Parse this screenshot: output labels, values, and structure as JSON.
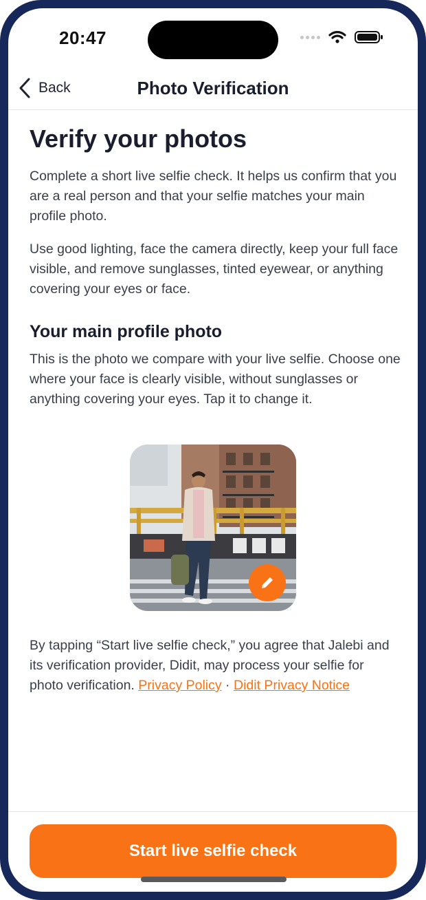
{
  "status_bar": {
    "time": "20:47"
  },
  "nav": {
    "back_label": "Back",
    "title": "Photo Verification"
  },
  "content": {
    "heading": "Verify your photos",
    "intro": "Complete a short live selfie check. It helps us confirm that you are a real person and that your selfie matches your main profile photo.",
    "tips": "Use good lighting, face the camera directly, keep your full face visible, and remove sunglasses, tinted eyewear, or anything covering your eyes or face.",
    "profile_heading": "Your main profile photo",
    "profile_desc": "This is the photo we compare with your live selfie. Choose one where your face is clearly visible, without sunglasses or anything covering your eyes. Tap it to change it."
  },
  "consent": {
    "text": "By tapping “Start live selfie check,” you agree that Jalebi and its verification provider, Didit, may process your selfie for photo verification. ",
    "privacy_policy": "Privacy Policy",
    "separator": " · ",
    "didit_notice": "Didit Privacy Notice"
  },
  "cta": {
    "label": "Start live selfie check"
  },
  "icons": {
    "back": "chevron-left-icon",
    "edit": "pencil-icon",
    "wifi": "wifi-icon",
    "battery": "battery-icon",
    "signal": "signal-icon"
  },
  "colors": {
    "accent": "#f97316",
    "frame": "#16285a",
    "text_dark": "#1a1d2e"
  }
}
